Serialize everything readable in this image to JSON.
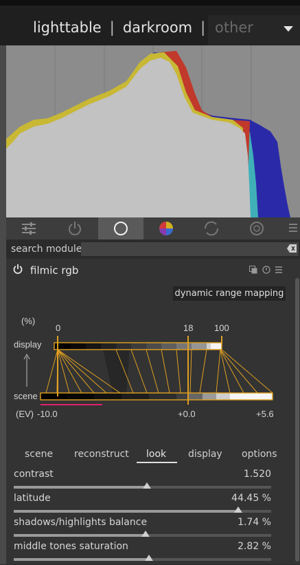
{
  "topbar": {
    "views": [
      "lighttable",
      "darkroom"
    ],
    "separator": "|",
    "other_label": "other"
  },
  "module_group_icons": [
    "presets-icon",
    "power-icon",
    "circle-icon",
    "color-wheel-icon",
    "refresh-icon",
    "lens-icon",
    "menu-icon"
  ],
  "search": {
    "label": "search module",
    "value": ""
  },
  "module": {
    "title": "filmic rgb",
    "mode_label": "dynamic range mapping",
    "graph": {
      "percent_label": "(%)",
      "display_label": "display",
      "scene_label": "scene",
      "ev_label": "(EV)",
      "display_ticks": [
        "0",
        "18",
        "100"
      ],
      "scene_ticks": [
        "-10.0",
        "+0.0",
        "+5.6"
      ]
    },
    "tabs": [
      "scene",
      "reconstruct",
      "look",
      "display",
      "options"
    ],
    "active_tab": "look",
    "sliders": [
      {
        "label": "contrast",
        "value": "1.520",
        "position": 0.517
      },
      {
        "label": "latitude",
        "value": "44.45 %",
        "position": 0.872
      },
      {
        "label": "shadows/highlights balance",
        "value": "1.74 %",
        "position": 0.512
      },
      {
        "label": "middle tones saturation",
        "value": "2.82 %",
        "position": 0.525
      }
    ]
  },
  "colors": {
    "accent": "#e0a020",
    "histogram_bg": "#8c8c8c"
  }
}
